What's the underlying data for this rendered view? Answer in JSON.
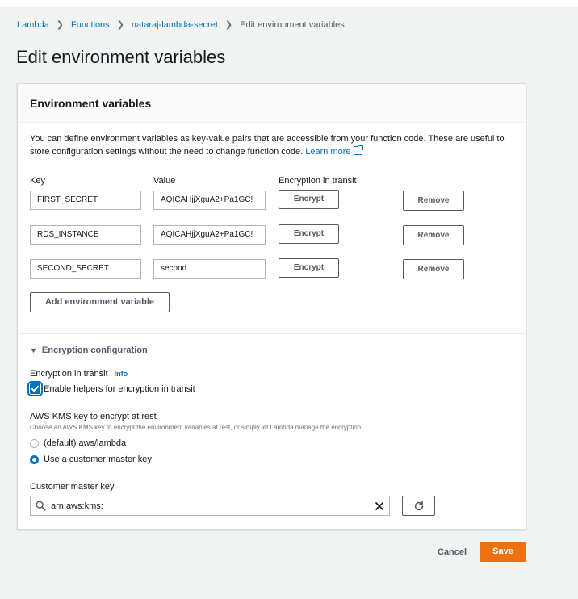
{
  "breadcrumb": {
    "items": [
      "Lambda",
      "Functions",
      "nataraj-lambda-secret"
    ],
    "current": "Edit environment variables"
  },
  "page_title": "Edit environment variables",
  "panel": {
    "title": "Environment variables",
    "description": "You can define environment variables as key-value pairs that are accessible from your function code. These are useful to store configuration settings without the need to change function code.",
    "learn_more": "Learn more",
    "columns": {
      "key": "Key",
      "value": "Value",
      "encryption": "Encryption in transit"
    },
    "variables": [
      {
        "key": "FIRST_SECRET",
        "value": "AQICAHjjXguA2+Pa1GC!",
        "encrypt_label": "Encrypt",
        "remove_label": "Remove"
      },
      {
        "key": "RDS_INSTANCE",
        "value": "AQICAHjjXguA2+Pa1GC!",
        "encrypt_label": "Encrypt",
        "remove_label": "Remove"
      },
      {
        "key": "SECOND_SECRET",
        "value": "second",
        "encrypt_label": "Encrypt",
        "remove_label": "Remove"
      }
    ],
    "add_label": "Add environment variable"
  },
  "encryption": {
    "section_title": "Encryption configuration",
    "transit_label": "Encryption in transit",
    "info": "Info",
    "enable_helpers_label": "Enable helpers for encryption in transit",
    "enable_helpers_checked": true,
    "kms_label": "AWS KMS key to encrypt at rest",
    "kms_hint": "Choose an AWS KMS key to encrypt the environment variables at rest, or simply let Lambda manage the encryption.",
    "options": [
      {
        "label": "(default) aws/lambda",
        "selected": false
      },
      {
        "label": "Use a customer master key",
        "selected": true
      }
    ],
    "cmk_label": "Customer master key",
    "cmk_value": "arn:aws:kms:"
  },
  "footer": {
    "cancel": "Cancel",
    "save": "Save"
  },
  "colors": {
    "link": "#0073bb",
    "primary": "#ec7211"
  }
}
